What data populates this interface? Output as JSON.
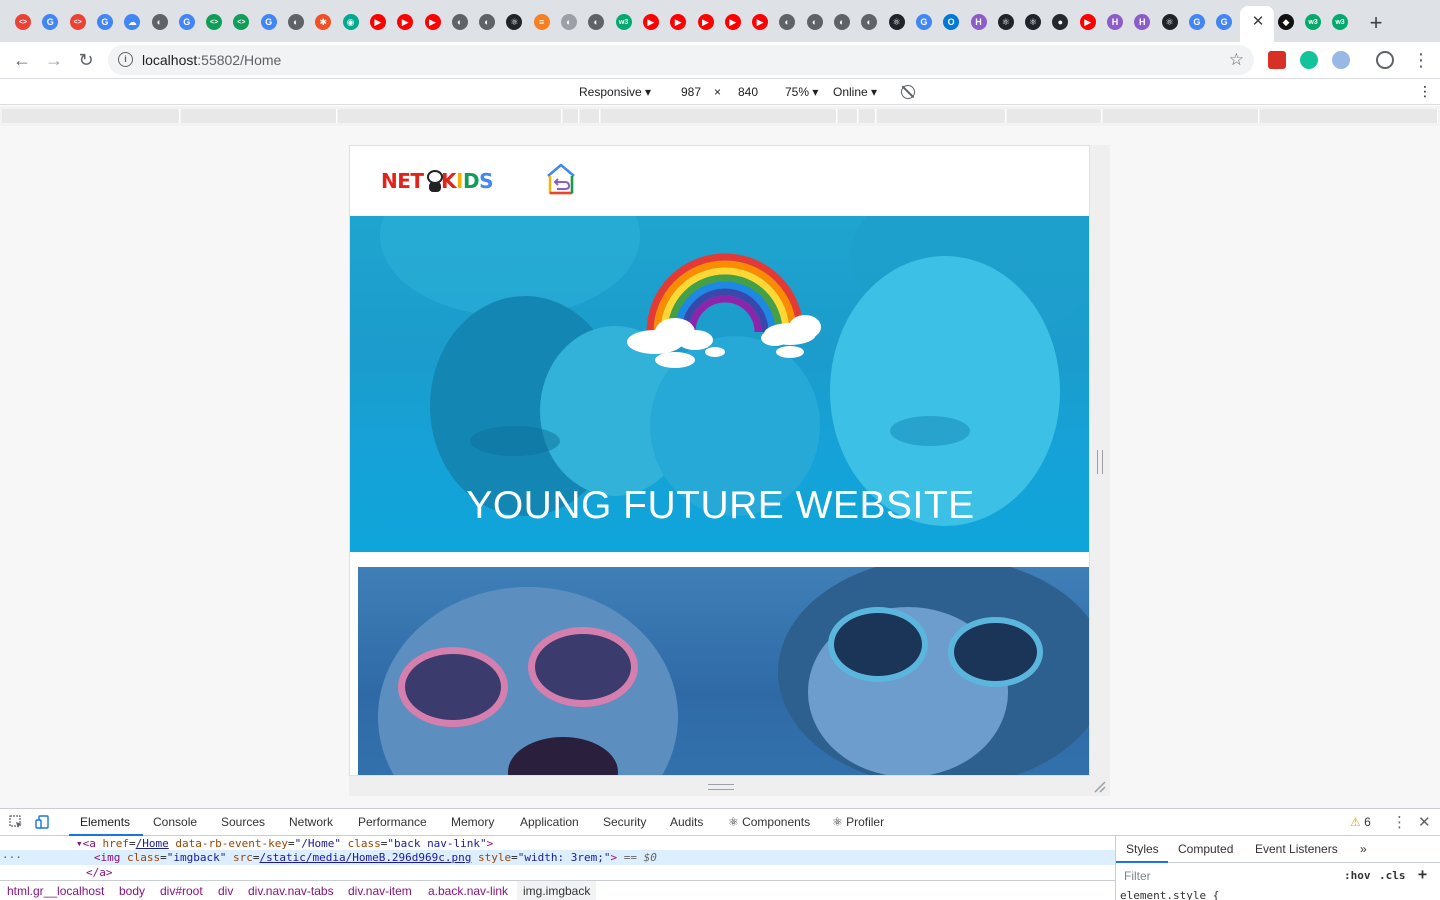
{
  "browser": {
    "tabs": [
      {
        "icon": "code-brackets-icon",
        "color": "#ea4335",
        "glyph": "<>"
      },
      {
        "icon": "google-icon",
        "color": "#4285f4",
        "glyph": "G"
      },
      {
        "icon": "code-brackets-icon",
        "color": "#ea4335",
        "glyph": "<>"
      },
      {
        "icon": "google-icon",
        "color": "#4285f4",
        "glyph": "G"
      },
      {
        "icon": "cloud-icon",
        "color": "#4285f4",
        "glyph": "☁"
      },
      {
        "icon": "globe-icon",
        "color": "#5f6368",
        "glyph": "◐"
      },
      {
        "icon": "google-icon",
        "color": "#4285f4",
        "glyph": "G"
      },
      {
        "icon": "code-brackets-icon",
        "color": "#0f9d58",
        "glyph": "<>"
      },
      {
        "icon": "code-brackets-icon",
        "color": "#0f9d58",
        "glyph": "<>"
      },
      {
        "icon": "google-icon",
        "color": "#4285f4",
        "glyph": "G"
      },
      {
        "icon": "globe-icon",
        "color": "#5f6368",
        "glyph": "◐"
      },
      {
        "icon": "asterisk-icon",
        "color": "#f25022",
        "glyph": "✱"
      },
      {
        "icon": "chat-icon",
        "color": "#00a98f",
        "glyph": "◉"
      },
      {
        "icon": "youtube-icon",
        "color": "#ff0000",
        "glyph": "▶"
      },
      {
        "icon": "youtube-icon",
        "color": "#ff0000",
        "glyph": "▶"
      },
      {
        "icon": "youtube-icon",
        "color": "#ff0000",
        "glyph": "▶"
      },
      {
        "icon": "globe-icon",
        "color": "#5f6368",
        "glyph": "◐"
      },
      {
        "icon": "globe-icon",
        "color": "#5f6368",
        "glyph": "◐"
      },
      {
        "icon": "react-icon",
        "color": "#20232a",
        "glyph": "⚛"
      },
      {
        "icon": "stackoverflow-icon",
        "color": "#f48024",
        "glyph": "≡"
      },
      {
        "icon": "globe-icon",
        "color": "#9aa0a6",
        "glyph": "◐"
      },
      {
        "icon": "globe-icon",
        "color": "#5f6368",
        "glyph": "◐"
      },
      {
        "icon": "w3-icon",
        "color": "#04aa6d",
        "glyph": "w3"
      },
      {
        "icon": "youtube-icon",
        "color": "#ff0000",
        "glyph": "▶"
      },
      {
        "icon": "youtube-icon",
        "color": "#ff0000",
        "glyph": "▶"
      },
      {
        "icon": "youtube-icon",
        "color": "#ff0000",
        "glyph": "▶"
      },
      {
        "icon": "youtube-icon",
        "color": "#ff0000",
        "glyph": "▶"
      },
      {
        "icon": "youtube-icon",
        "color": "#ff0000",
        "glyph": "▶"
      },
      {
        "icon": "globe-icon",
        "color": "#5f6368",
        "glyph": "◐"
      },
      {
        "icon": "globe-icon",
        "color": "#5f6368",
        "glyph": "◐"
      },
      {
        "icon": "globe-icon",
        "color": "#5f6368",
        "glyph": "◐"
      },
      {
        "icon": "globe-icon",
        "color": "#5f6368",
        "glyph": "◐"
      },
      {
        "icon": "react-icon",
        "color": "#20232a",
        "glyph": "⚛"
      },
      {
        "icon": "google-icon",
        "color": "#4285f4",
        "glyph": "G"
      },
      {
        "icon": "outlook-icon",
        "color": "#0078d4",
        "glyph": "O"
      },
      {
        "icon": "hyperskill-icon",
        "color": "#8c5cc7",
        "glyph": "H"
      },
      {
        "icon": "react-icon",
        "color": "#20232a",
        "glyph": "⚛"
      },
      {
        "icon": "react-icon",
        "color": "#20232a",
        "glyph": "⚛"
      },
      {
        "icon": "github-icon",
        "color": "#24292e",
        "glyph": "●"
      },
      {
        "icon": "youtube-icon",
        "color": "#ff0000",
        "glyph": "▶"
      },
      {
        "icon": "hyperskill-icon",
        "color": "#8c5cc7",
        "glyph": "H"
      },
      {
        "icon": "hyperskill-icon",
        "color": "#8c5cc7",
        "glyph": "H"
      },
      {
        "icon": "react-icon",
        "color": "#20232a",
        "glyph": "⚛"
      },
      {
        "icon": "google-icon",
        "color": "#4285f4",
        "glyph": "G"
      },
      {
        "icon": "translate-icon",
        "color": "#4285f4",
        "glyph": "G"
      }
    ],
    "tabs_after_active": [
      {
        "icon": "codepen-icon",
        "color": "#111111",
        "glyph": "◆"
      },
      {
        "icon": "w3-icon",
        "color": "#04aa6d",
        "glyph": "w3"
      },
      {
        "icon": "w3-icon",
        "color": "#04aa6d",
        "glyph": "w3"
      }
    ],
    "close_glyph": "✕",
    "new_tab_glyph": "+",
    "url_host": "localhost",
    "url_rest": ":55802/Home",
    "info_glyph": "i",
    "star_glyph": "☆"
  },
  "device_toolbar": {
    "mode": "Responsive ▾",
    "width": "987",
    "times": "×",
    "height": "840",
    "zoom": "75% ▾",
    "network": "Online ▾",
    "more": "⋮"
  },
  "site": {
    "logo": {
      "net": "NET",
      "k": "K",
      "i": "I",
      "d": "D",
      "s": "S"
    },
    "hero_title": "YOUNG FUTURE WEBSITE",
    "colors": {
      "hero": "#1ba3d6",
      "logo_red": "#e2231a"
    }
  },
  "devtools": {
    "tabs": [
      "Elements",
      "Console",
      "Sources",
      "Network",
      "Performance",
      "Memory",
      "Application",
      "Security",
      "Audits",
      "⚛ Components",
      "⚛ Profiler"
    ],
    "warning_count": "6",
    "warning_glyph": "⚠",
    "kebab": "⋮",
    "close": "✕",
    "elements": {
      "line1": {
        "tag_open": "▾<a ",
        "href_attr": "href",
        "href_val": "/Home",
        "rb_attr": "data-rb-event-key",
        "rb_val": "\"/Home\"",
        "class_attr": "class",
        "class_val": "\"back nav-link\"",
        "tag_close": ">"
      },
      "line2": {
        "dots": "···",
        "tag_open": "<img ",
        "class_attr": "class",
        "class_val": "\"imgback\"",
        "src_attr": "src",
        "src_val": "/static/media/HomeB.296d969c.png",
        "style_attr": "style",
        "style_val": "\"width: 3rem;\"",
        "tag_close": ">",
        "eq": " == $0"
      },
      "line3": {
        "tag": "</a>"
      }
    },
    "breadcrumbs": [
      "html.gr__localhost",
      "body",
      "div#root",
      "div",
      "div.nav.nav-tabs",
      "div.nav-item",
      "a.back.nav-link",
      "img.imgback"
    ],
    "styles_tabs": [
      "Styles",
      "Computed",
      "Event Listeners",
      "»"
    ],
    "filter_placeholder": "Filter",
    "hov": ":hov",
    "cls": ".cls",
    "add": "+",
    "element_style": "element.style {"
  }
}
